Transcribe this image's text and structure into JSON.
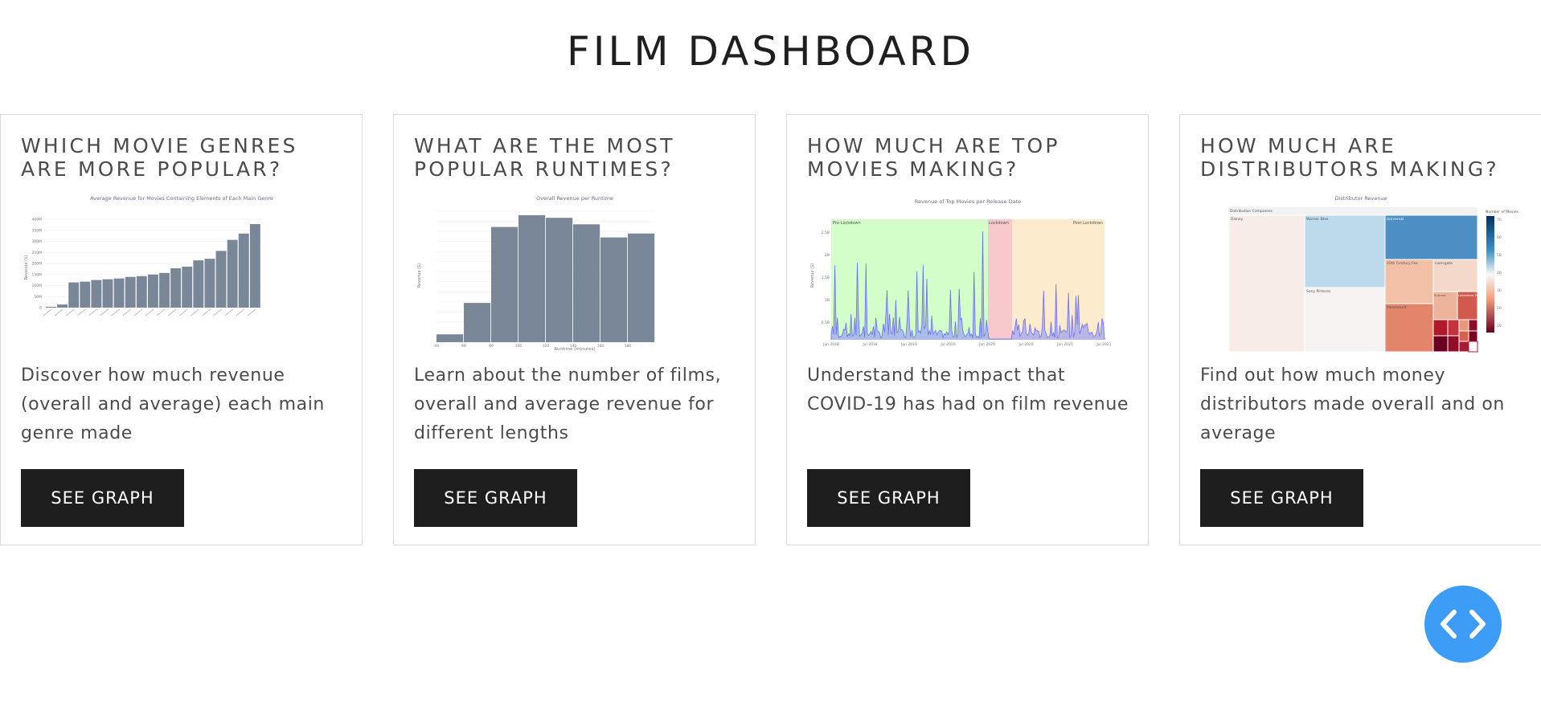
{
  "page": {
    "title": "FILM DASHBOARD"
  },
  "cards": [
    {
      "title": "WHICH MOVIE GENRES ARE MORE POPULAR?",
      "description": "Discover how much revenue (overall and average) each main genre made",
      "button": "SEE GRAPH",
      "chart_title": "Average Revenue for Movies Containing Elements of Each Main Genre",
      "chart_ylabel": "Revenue ($)",
      "chart_yticks": [
        "0",
        "50M",
        "100M",
        "150M",
        "200M",
        "250M",
        "300M",
        "350M",
        "400M"
      ]
    },
    {
      "title": "WHAT ARE THE MOST POPULAR RUNTIMES?",
      "description": "Learn about the number of films, overall and average revenue for different lengths",
      "button": "SEE GRAPH",
      "chart_title": "Overall Revenue per Runtime",
      "chart_xlabel": "Runtime (minutes)",
      "chart_ylabel": "Revenue ($)",
      "chart_xticks": [
        "40",
        "60",
        "80",
        "100",
        "120",
        "140",
        "160",
        "180"
      ]
    },
    {
      "title": "HOW MUCH ARE TOP MOVIES MAKING?",
      "description": "Understand the impact that COVID-19 has had on film revenue",
      "button": "SEE GRAPH",
      "chart_title": "Revenue of Top Movies per Release Date",
      "chart_ylabel": "Revenue ($)",
      "zone_labels": [
        "Pre-Lockdown",
        "Lockdown",
        "Post-Lockdown"
      ],
      "chart_yticks": [
        "0.5B",
        "1B",
        "1.5B",
        "2B",
        "2.5B"
      ],
      "chart_xticks": [
        "Jan 2018",
        "Jul 2018",
        "Jan 2019",
        "Jul 2019",
        "Jan 2020",
        "Jul 2020",
        "Jan 2021",
        "Jul 2021"
      ]
    },
    {
      "title": "HOW MUCH ARE DISTRIBUTORS MAKING?",
      "description": "Find out how much money distributors made overall and on average",
      "button": "SEE GRAPH",
      "chart_title": "Distributor Revenue",
      "root_label": "Distribution Companies",
      "legend_title": "Number of Movies",
      "tiles": [
        "Disney",
        "Warner Bros",
        "Universal",
        "Sony Pictures",
        "20th Century Fox",
        "Lionsgate",
        "Paramount",
        "Summit",
        "Lakeshore Films"
      ],
      "legend_ticks": [
        "70",
        "60",
        "50",
        "40",
        "30",
        "20",
        "10"
      ]
    }
  ],
  "chart_data": [
    {
      "type": "bar",
      "title": "Average Revenue for Movies Containing Elements of Each Main Genre",
      "ylabel": "Revenue ($)",
      "ylim": [
        0,
        420000000
      ],
      "values": [
        5000000,
        20000000,
        160000000,
        165000000,
        175000000,
        180000000,
        185000000,
        195000000,
        200000000,
        210000000,
        220000000,
        250000000,
        260000000,
        300000000,
        310000000,
        360000000,
        430000000,
        470000000,
        530000000
      ]
    },
    {
      "type": "bar",
      "title": "Overall Revenue per Runtime",
      "xlabel": "Runtime (minutes)",
      "ylabel": "Revenue ($)",
      "values": [
        0.06,
        0.3,
        0.88,
        0.97,
        0.95,
        0.9,
        0.8,
        0.83
      ]
    },
    {
      "type": "area",
      "title": "Revenue of Top Movies per Release Date",
      "ylabel": "Revenue ($)"
    }
  ]
}
